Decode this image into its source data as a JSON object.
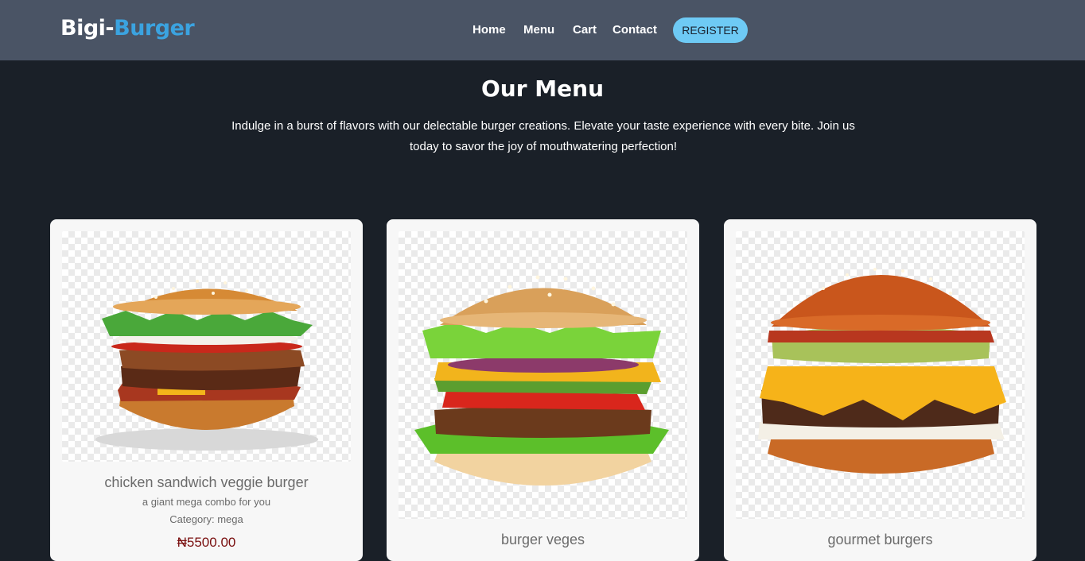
{
  "brand": {
    "part1": "Bigi-",
    "part2": "Burger"
  },
  "nav": {
    "home": "Home",
    "menu": "Menu",
    "cart": "Cart",
    "contact": "Contact",
    "register": "REGISTER"
  },
  "section": {
    "title": "Our Menu",
    "intro": "Indulge in a burst of flavors with our delectable burger creations. Elevate your taste experience with every bite. Join us today to savor the joy of mouthwatering perfection!"
  },
  "products": [
    {
      "name": "chicken sandwich veggie burger",
      "description": "a giant mega combo for you",
      "category": "Category: mega",
      "price": "₦5500.00"
    },
    {
      "name": "burger veges"
    },
    {
      "name": "gourmet burgers"
    }
  ],
  "colors": {
    "navbar": "#4a5465",
    "page_bg": "#1a2028",
    "brand_accent": "#3ba3e0",
    "register_button": "#6ecaf5",
    "price": "#7a1010"
  }
}
